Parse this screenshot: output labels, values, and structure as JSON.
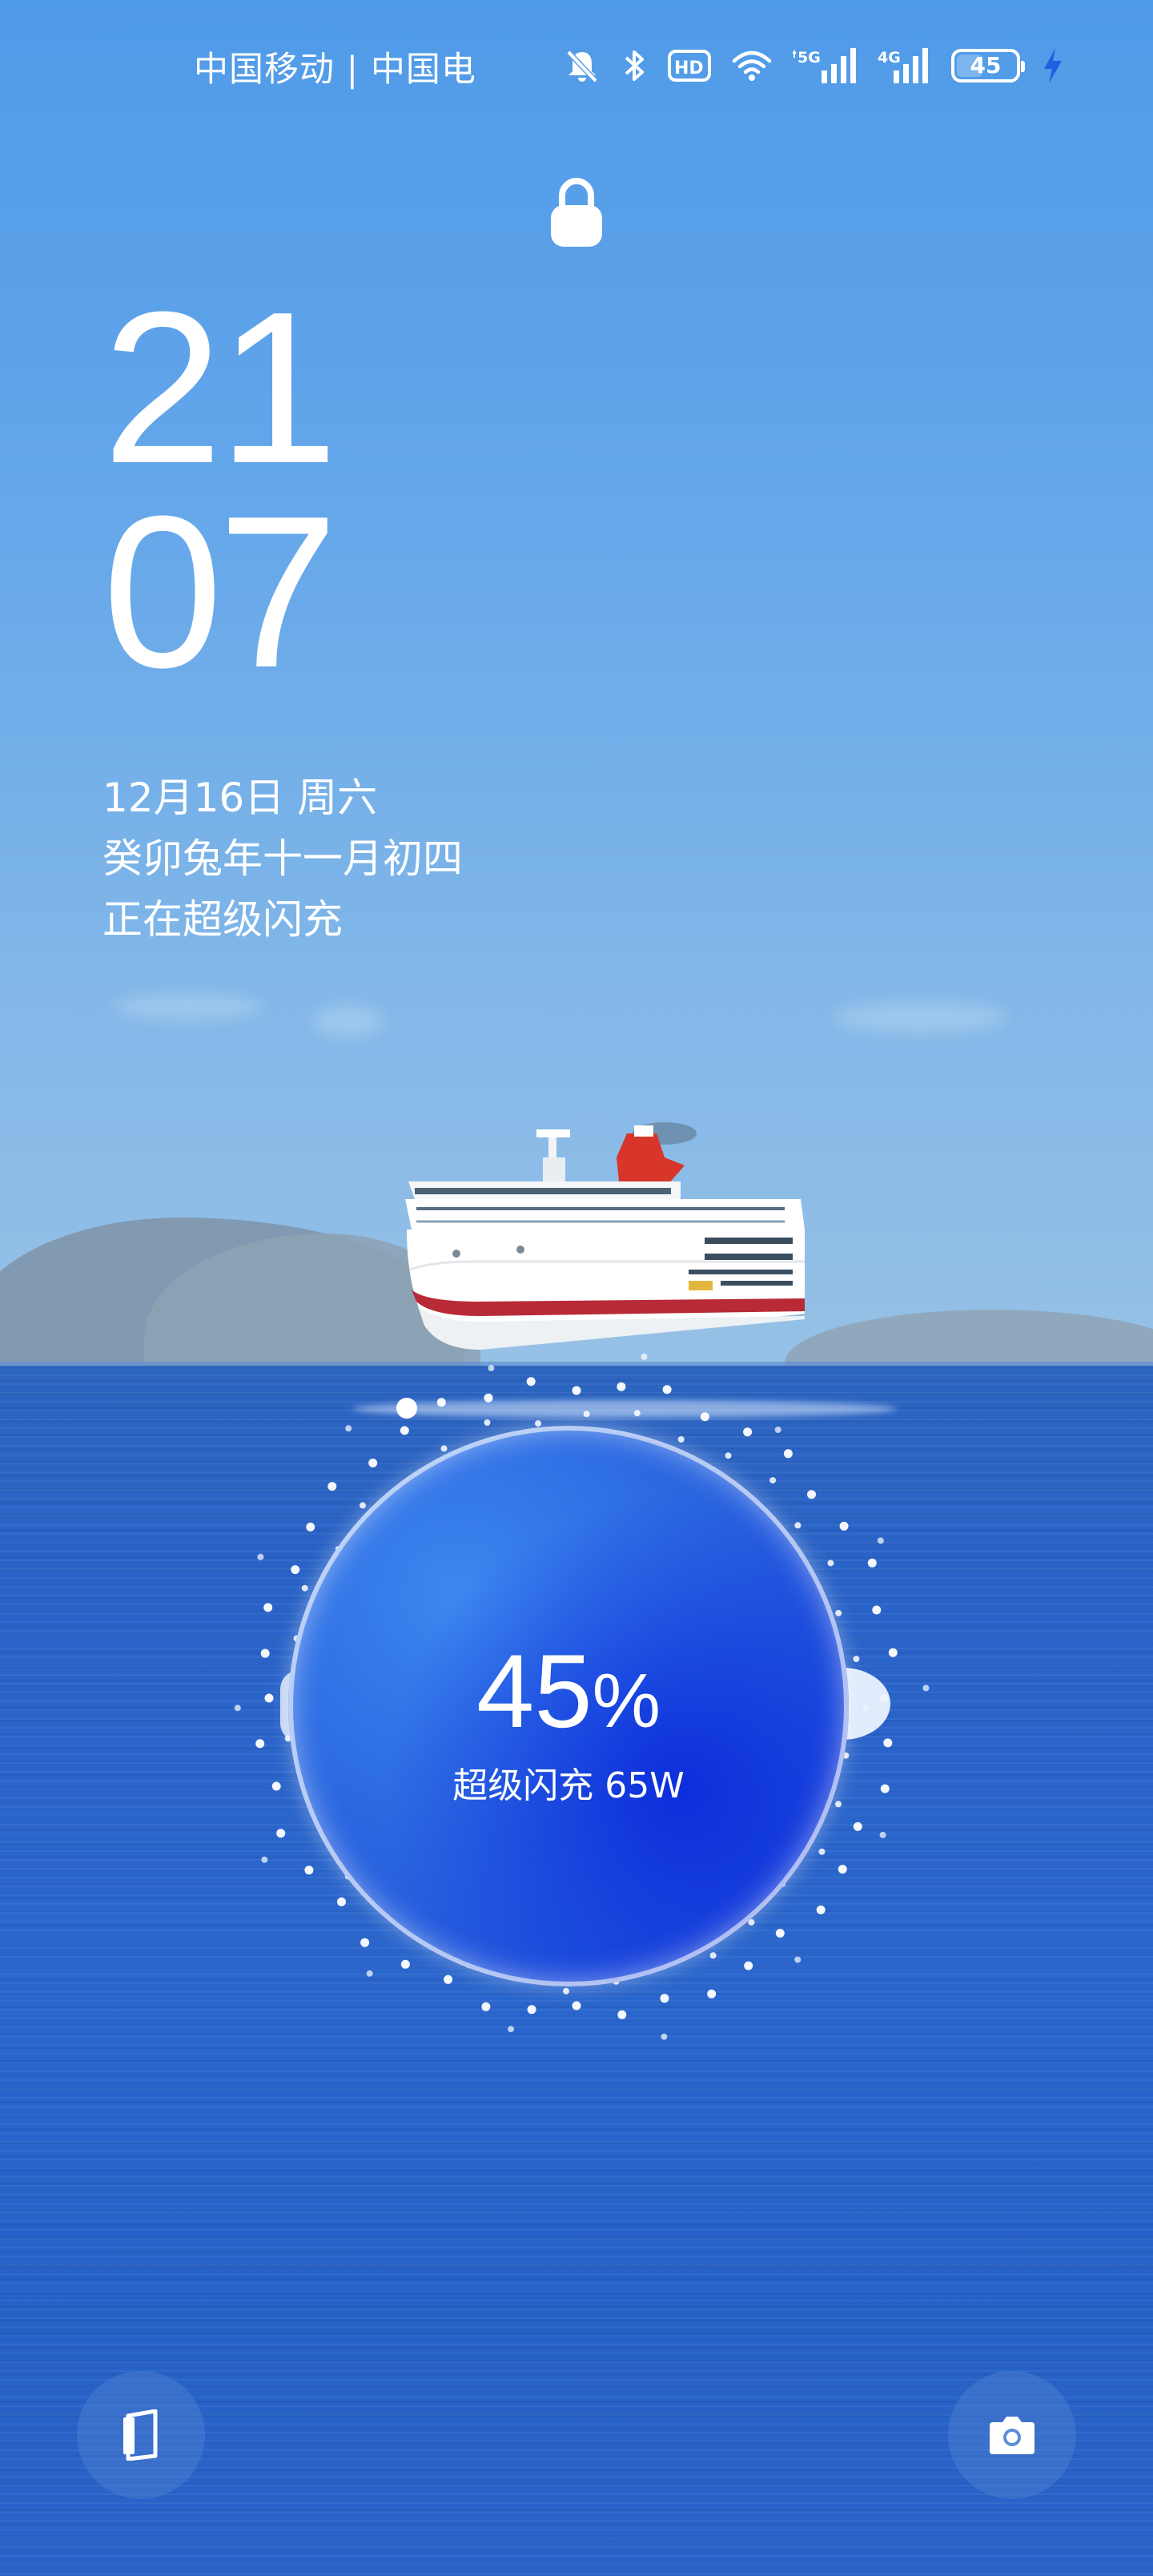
{
  "status_bar": {
    "carrier": "中国移动 | 中国电",
    "icons": [
      "mute-icon",
      "bluetooth-icon",
      "hd-voice-icon",
      "wifi-icon",
      "5g-signal-icon",
      "4g-signal-icon",
      "battery-icon",
      "charging-bolt-icon"
    ],
    "network_5g": "5G",
    "network_4g": "4G",
    "hd_label": "HD",
    "battery_level": "45"
  },
  "lock_screen": {
    "lock_icon": "padlock-icon",
    "clock_hour": "21",
    "clock_minute": "07",
    "date": "12月16日 周六",
    "lunar_date": "癸卯兔年十一月初四",
    "charging_status": "正在超级闪充"
  },
  "charging": {
    "percent": "45",
    "percent_sign": "%",
    "label": "超级闪充 65W",
    "level_fraction": 0.45
  },
  "shortcuts": {
    "left_icon": "wallet-card-icon",
    "right_icon": "camera-icon"
  },
  "colors": {
    "sky": "#63a6ea",
    "sea": "#2a63c8",
    "orb": "#2a67e0",
    "charging_bolt": "#1f5fe0"
  }
}
